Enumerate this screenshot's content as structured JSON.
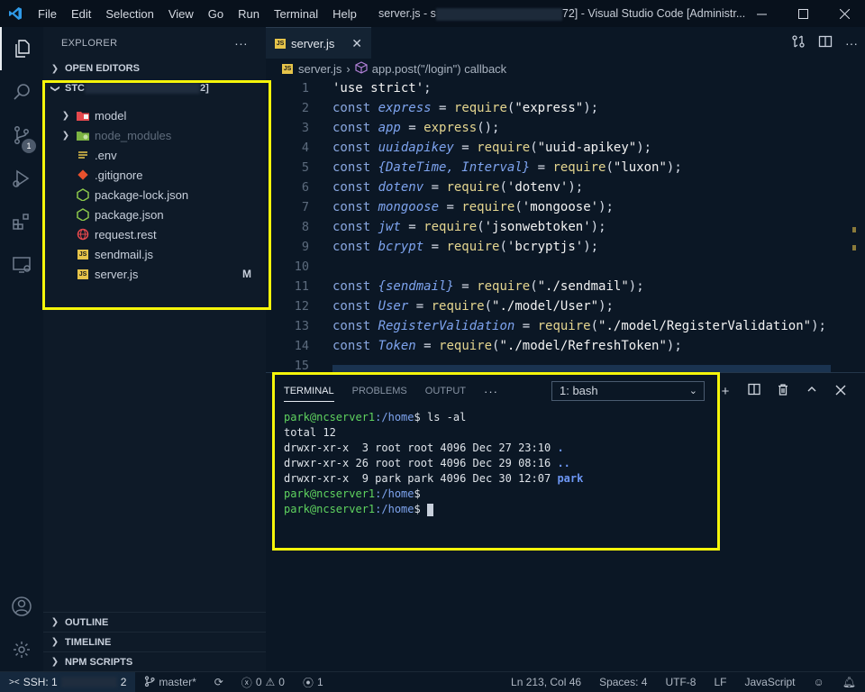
{
  "window": {
    "title_prefix": "server.js - s",
    "title_suffix": "72] - Visual Studio Code [Administr...",
    "menu": [
      "File",
      "Edit",
      "Selection",
      "View",
      "Go",
      "Run",
      "Terminal",
      "Help"
    ]
  },
  "activity": {
    "scm_badge": "1"
  },
  "sidebar": {
    "header": "EXPLORER",
    "more": "···",
    "open_editors": "OPEN EDITORS",
    "folder_prefix": "STC",
    "folder_suffix": "2]",
    "files": [
      {
        "name": "model",
        "type": "folder",
        "icon": "model-folder-icon"
      },
      {
        "name": "node_modules",
        "type": "folder",
        "icon": "node-folder-icon"
      },
      {
        "name": ".env",
        "type": "file",
        "icon": "env-icon"
      },
      {
        "name": ".gitignore",
        "type": "file",
        "icon": "git-icon"
      },
      {
        "name": "package-lock.json",
        "type": "file",
        "icon": "nodejs-icon"
      },
      {
        "name": "package.json",
        "type": "file",
        "icon": "nodejs-icon"
      },
      {
        "name": "request.rest",
        "type": "file",
        "icon": "globe-icon"
      },
      {
        "name": "sendmail.js",
        "type": "file",
        "icon": "js-icon"
      },
      {
        "name": "server.js",
        "type": "file",
        "icon": "js-icon",
        "status": "M"
      }
    ],
    "bottom_sections": [
      "OUTLINE",
      "TIMELINE",
      "NPM SCRIPTS"
    ]
  },
  "editor": {
    "tab": "server.js",
    "breadcrumb": {
      "file": "server.js",
      "symbol": "app.post(\"/login\") callback"
    },
    "line_numbers": [
      "1",
      "2",
      "3",
      "4",
      "5",
      "6",
      "7",
      "8",
      "9",
      "10",
      "11",
      "12",
      "13",
      "14",
      "15"
    ]
  },
  "panel": {
    "tabs": [
      "TERMINAL",
      "PROBLEMS",
      "OUTPUT"
    ],
    "more": "···",
    "terminal_select": "1: bash",
    "prompt_user": "park@ncserver1",
    "prompt_path": ":/home",
    "prompt_end": "$",
    "command": " ls -al",
    "output": {
      "total": "total 12",
      "rows": [
        {
          "prefix": "drwxr-xr-x  3 root root 4096 Dec 27 23:10 ",
          "name": "."
        },
        {
          "prefix": "drwxr-xr-x 26 root root 4096 Dec 29 08:16 ",
          "name": ".."
        },
        {
          "prefix": "drwxr-xr-x  9 park park 4096 Dec 30 12:07 ",
          "name": "park"
        }
      ]
    }
  },
  "status": {
    "remote_prefix": "SSH: 1",
    "remote_suffix": "2",
    "branch": "master*",
    "errors": "0",
    "warnings": "0",
    "ports": "1",
    "position": "Ln 213, Col 46",
    "spaces": "Spaces: 4",
    "encoding": "UTF-8",
    "eol": "LF",
    "language": "JavaScript"
  }
}
